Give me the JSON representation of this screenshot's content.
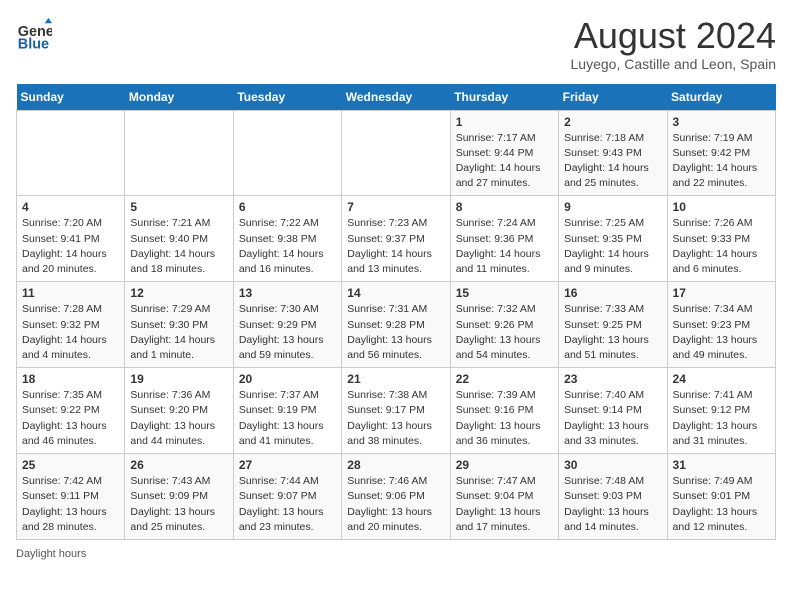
{
  "header": {
    "logo_line1": "General",
    "logo_line2": "Blue",
    "month_year": "August 2024",
    "location": "Luyego, Castille and Leon, Spain"
  },
  "days_of_week": [
    "Sunday",
    "Monday",
    "Tuesday",
    "Wednesday",
    "Thursday",
    "Friday",
    "Saturday"
  ],
  "weeks": [
    [
      {
        "day": "",
        "content": ""
      },
      {
        "day": "",
        "content": ""
      },
      {
        "day": "",
        "content": ""
      },
      {
        "day": "",
        "content": ""
      },
      {
        "day": "1",
        "content": "Sunrise: 7:17 AM\nSunset: 9:44 PM\nDaylight: 14 hours and 27 minutes."
      },
      {
        "day": "2",
        "content": "Sunrise: 7:18 AM\nSunset: 9:43 PM\nDaylight: 14 hours and 25 minutes."
      },
      {
        "day": "3",
        "content": "Sunrise: 7:19 AM\nSunset: 9:42 PM\nDaylight: 14 hours and 22 minutes."
      }
    ],
    [
      {
        "day": "4",
        "content": "Sunrise: 7:20 AM\nSunset: 9:41 PM\nDaylight: 14 hours and 20 minutes."
      },
      {
        "day": "5",
        "content": "Sunrise: 7:21 AM\nSunset: 9:40 PM\nDaylight: 14 hours and 18 minutes."
      },
      {
        "day": "6",
        "content": "Sunrise: 7:22 AM\nSunset: 9:38 PM\nDaylight: 14 hours and 16 minutes."
      },
      {
        "day": "7",
        "content": "Sunrise: 7:23 AM\nSunset: 9:37 PM\nDaylight: 14 hours and 13 minutes."
      },
      {
        "day": "8",
        "content": "Sunrise: 7:24 AM\nSunset: 9:36 PM\nDaylight: 14 hours and 11 minutes."
      },
      {
        "day": "9",
        "content": "Sunrise: 7:25 AM\nSunset: 9:35 PM\nDaylight: 14 hours and 9 minutes."
      },
      {
        "day": "10",
        "content": "Sunrise: 7:26 AM\nSunset: 9:33 PM\nDaylight: 14 hours and 6 minutes."
      }
    ],
    [
      {
        "day": "11",
        "content": "Sunrise: 7:28 AM\nSunset: 9:32 PM\nDaylight: 14 hours and 4 minutes."
      },
      {
        "day": "12",
        "content": "Sunrise: 7:29 AM\nSunset: 9:30 PM\nDaylight: 14 hours and 1 minute."
      },
      {
        "day": "13",
        "content": "Sunrise: 7:30 AM\nSunset: 9:29 PM\nDaylight: 13 hours and 59 minutes."
      },
      {
        "day": "14",
        "content": "Sunrise: 7:31 AM\nSunset: 9:28 PM\nDaylight: 13 hours and 56 minutes."
      },
      {
        "day": "15",
        "content": "Sunrise: 7:32 AM\nSunset: 9:26 PM\nDaylight: 13 hours and 54 minutes."
      },
      {
        "day": "16",
        "content": "Sunrise: 7:33 AM\nSunset: 9:25 PM\nDaylight: 13 hours and 51 minutes."
      },
      {
        "day": "17",
        "content": "Sunrise: 7:34 AM\nSunset: 9:23 PM\nDaylight: 13 hours and 49 minutes."
      }
    ],
    [
      {
        "day": "18",
        "content": "Sunrise: 7:35 AM\nSunset: 9:22 PM\nDaylight: 13 hours and 46 minutes."
      },
      {
        "day": "19",
        "content": "Sunrise: 7:36 AM\nSunset: 9:20 PM\nDaylight: 13 hours and 44 minutes."
      },
      {
        "day": "20",
        "content": "Sunrise: 7:37 AM\nSunset: 9:19 PM\nDaylight: 13 hours and 41 minutes."
      },
      {
        "day": "21",
        "content": "Sunrise: 7:38 AM\nSunset: 9:17 PM\nDaylight: 13 hours and 38 minutes."
      },
      {
        "day": "22",
        "content": "Sunrise: 7:39 AM\nSunset: 9:16 PM\nDaylight: 13 hours and 36 minutes."
      },
      {
        "day": "23",
        "content": "Sunrise: 7:40 AM\nSunset: 9:14 PM\nDaylight: 13 hours and 33 minutes."
      },
      {
        "day": "24",
        "content": "Sunrise: 7:41 AM\nSunset: 9:12 PM\nDaylight: 13 hours and 31 minutes."
      }
    ],
    [
      {
        "day": "25",
        "content": "Sunrise: 7:42 AM\nSunset: 9:11 PM\nDaylight: 13 hours and 28 minutes."
      },
      {
        "day": "26",
        "content": "Sunrise: 7:43 AM\nSunset: 9:09 PM\nDaylight: 13 hours and 25 minutes."
      },
      {
        "day": "27",
        "content": "Sunrise: 7:44 AM\nSunset: 9:07 PM\nDaylight: 13 hours and 23 minutes."
      },
      {
        "day": "28",
        "content": "Sunrise: 7:46 AM\nSunset: 9:06 PM\nDaylight: 13 hours and 20 minutes."
      },
      {
        "day": "29",
        "content": "Sunrise: 7:47 AM\nSunset: 9:04 PM\nDaylight: 13 hours and 17 minutes."
      },
      {
        "day": "30",
        "content": "Sunrise: 7:48 AM\nSunset: 9:03 PM\nDaylight: 13 hours and 14 minutes."
      },
      {
        "day": "31",
        "content": "Sunrise: 7:49 AM\nSunset: 9:01 PM\nDaylight: 13 hours and 12 minutes."
      }
    ]
  ],
  "footer": {
    "note": "Daylight hours"
  }
}
